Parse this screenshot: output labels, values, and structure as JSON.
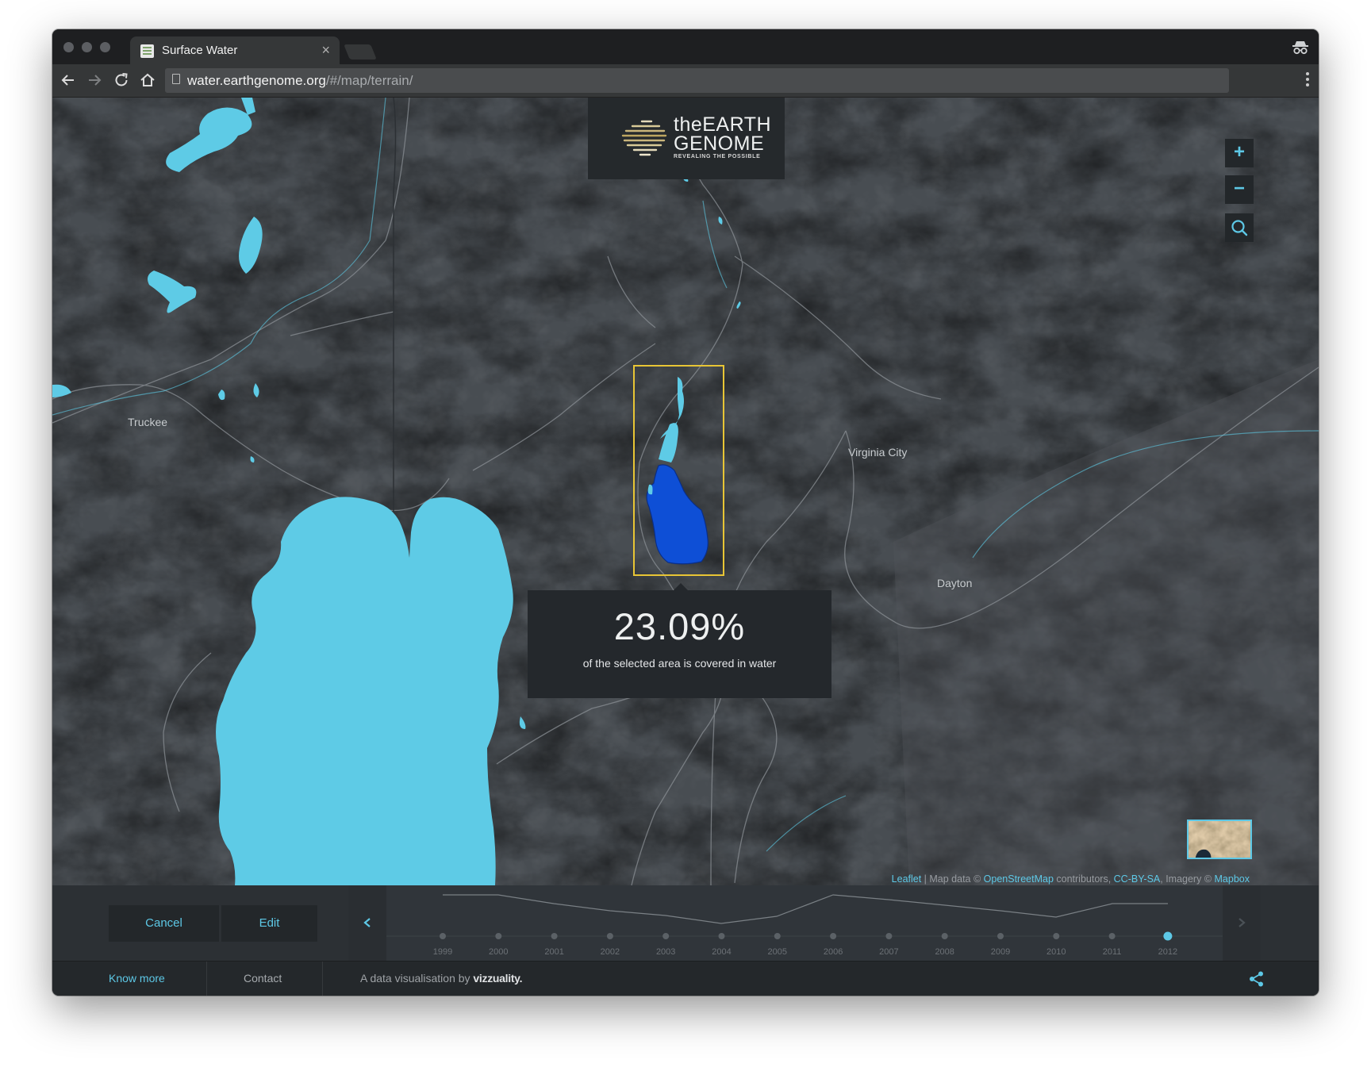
{
  "browser": {
    "tab_title": "Surface Water",
    "url_host": "water.earthgenome.org",
    "url_path": "/#/map/terrain/"
  },
  "logo": {
    "line1": "theEARTH",
    "line2": "GENOME",
    "tagline": "REVEALING THE POSSIBLE"
  },
  "map": {
    "zoom_in": "+",
    "zoom_out": "−",
    "places": {
      "truckee": "Truckee",
      "virginia_city": "Virginia City",
      "dayton": "Dayton"
    },
    "colors": {
      "water": "#5ecbe6",
      "selected_water": "#0e4fd6",
      "selection_border": "#e8c535",
      "accent": "#5dc8e6"
    }
  },
  "tooltip": {
    "value": "23.09%",
    "label": "of the selected area is covered in water"
  },
  "attribution": {
    "leaflet": "Leaflet",
    "map_data": " | Map data © ",
    "osm": "OpenStreetMap",
    "contributors": " contributors, ",
    "license": "CC-BY-SA",
    "imagery": ", Imagery © ",
    "mapbox": "Mapbox"
  },
  "timeline": {
    "cancel_label": "Cancel",
    "edit_label": "Edit",
    "selected_year": "2012",
    "years": [
      "1999",
      "2000",
      "2001",
      "2002",
      "2003",
      "2004",
      "2005",
      "2006",
      "2007",
      "2008",
      "2009",
      "2010",
      "2011",
      "2012"
    ]
  },
  "footer": {
    "know_more": "Know more",
    "contact": "Contact",
    "credit_prefix": "A data visualisation by ",
    "credit_brand": "vizzuality."
  }
}
